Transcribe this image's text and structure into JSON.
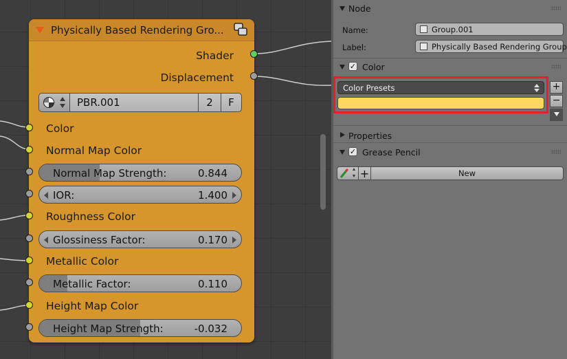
{
  "node": {
    "title": "Physically Based Rendering Gro...",
    "outputs": {
      "shader": "Shader",
      "displacement": "Displacement"
    },
    "datablock": {
      "name": "PBR.001",
      "users": "2",
      "fake_user": "F"
    },
    "inputs": {
      "color": "Color",
      "normal_map_color": "Normal Map Color",
      "roughness_color": "Roughness Color",
      "metallic_color": "Metallic Color",
      "height_map_color": "Height Map Color"
    },
    "fields": {
      "normal_map_strength": {
        "label": "Normal Map Strength:",
        "value": "0.844",
        "fill": 0.3
      },
      "ior": {
        "label": "IOR:",
        "value": "1.400"
      },
      "glossiness_factor": {
        "label": "Glossiness Factor:",
        "value": "0.170"
      },
      "metallic_factor": {
        "label": "Metallic Factor:",
        "value": "0.110",
        "fill": 0.14
      },
      "height_map_strength": {
        "label": "Height Map Strength:",
        "value": "-0.032",
        "fill": 0.5
      }
    }
  },
  "panel": {
    "node_section": {
      "title": "Node",
      "name_label": "Name:",
      "name_value": "Group.001",
      "label_label": "Label:",
      "label_value": "Physically Based Rendering Group"
    },
    "color_section": {
      "title": "Color",
      "presets_label": "Color Presets",
      "color_value": "#ffd75c",
      "add_button": "+",
      "remove_button": "−"
    },
    "properties_section": {
      "title": "Properties"
    },
    "grease_pencil_section": {
      "title": "Grease Pencil",
      "add_button": "+",
      "new_button": "New"
    }
  },
  "colors": {
    "node_body": "#d6962c",
    "node_header": "#c9892a",
    "highlight_box": "#e5202a",
    "shader_socket": "#5fcf5f",
    "color_socket": "#d4d42e",
    "value_socket": "#9d9d9d"
  }
}
